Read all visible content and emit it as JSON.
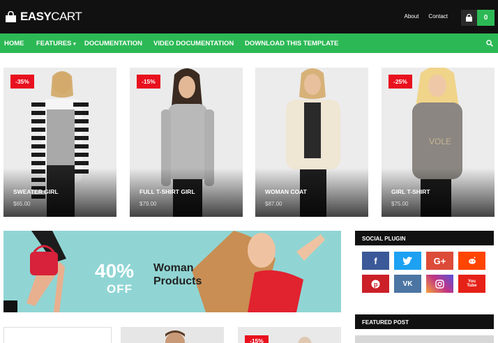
{
  "header": {
    "logo_text_bold": "EASY",
    "logo_text_light": "CART",
    "links": [
      "About",
      "Contact"
    ],
    "cart_count": "0"
  },
  "nav": {
    "items": [
      "HOME",
      "FEATURES",
      "DOCUMENTATION",
      "VIDEO DOCUMENTATION",
      "DOWNLOAD THIS TEMPLATE"
    ]
  },
  "products": [
    {
      "name": "SWEATER GIRL",
      "price": "$65.00",
      "badge": "-35%"
    },
    {
      "name": "FULL T-SHIRT GIRL",
      "price": "$79.00",
      "badge": "-15%"
    },
    {
      "name": "WOMAN COAT",
      "price": "$87.00",
      "badge": ""
    },
    {
      "name": "GIRL T-SHIRT",
      "price": "$75.00",
      "badge": "-25%"
    }
  ],
  "banner": {
    "discount": "40%",
    "off": "OFF",
    "title_line1": "Woman",
    "title_line2": "Products"
  },
  "sidebar": {
    "social_title": "SOCIAL PLUGIN",
    "featured_title": "FEATURED POST",
    "social": [
      {
        "icon": "facebook-icon",
        "glyph": "f",
        "color": "#3b5998"
      },
      {
        "icon": "twitter-icon",
        "glyph": "",
        "color": "#1da1f2"
      },
      {
        "icon": "google-plus-icon",
        "glyph": "G+",
        "color": "#dd4b39"
      },
      {
        "icon": "reddit-icon",
        "glyph": "",
        "color": "#ff4500"
      },
      {
        "icon": "pinterest-icon",
        "glyph": "P",
        "color": "#cb2027"
      },
      {
        "icon": "vk-icon",
        "glyph": "VK",
        "color": "#4c75a3"
      },
      {
        "icon": "instagram-icon",
        "glyph": "",
        "color": "#c13584"
      },
      {
        "icon": "youtube-icon",
        "glyph": "You Tube",
        "color": "#e62117"
      }
    ]
  },
  "bottom": {
    "badge": "-15%"
  },
  "colors": {
    "accent_green": "#2cb955",
    "sale_red": "#e8101e",
    "header_black": "#111111",
    "banner_teal": "#8fd4d3"
  }
}
